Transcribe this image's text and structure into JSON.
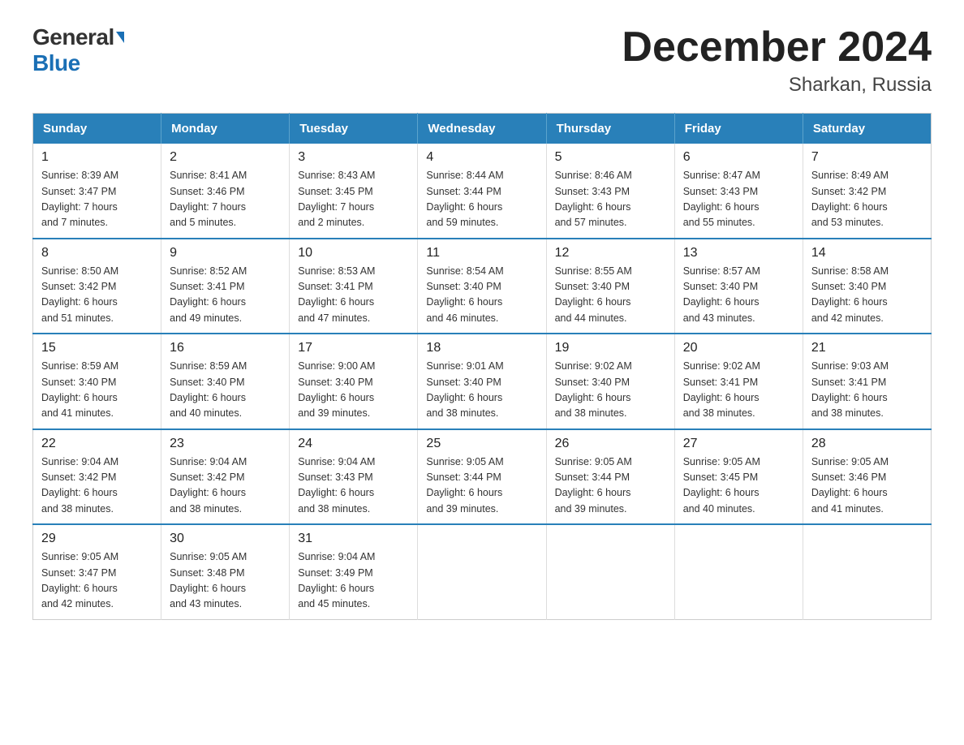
{
  "logo": {
    "general": "General",
    "blue": "Blue"
  },
  "title": "December 2024",
  "subtitle": "Sharkan, Russia",
  "headers": [
    "Sunday",
    "Monday",
    "Tuesday",
    "Wednesday",
    "Thursday",
    "Friday",
    "Saturday"
  ],
  "weeks": [
    [
      {
        "day": "1",
        "sunrise": "8:39 AM",
        "sunset": "3:47 PM",
        "daylight": "7 hours and 7 minutes."
      },
      {
        "day": "2",
        "sunrise": "8:41 AM",
        "sunset": "3:46 PM",
        "daylight": "7 hours and 5 minutes."
      },
      {
        "day": "3",
        "sunrise": "8:43 AM",
        "sunset": "3:45 PM",
        "daylight": "7 hours and 2 minutes."
      },
      {
        "day": "4",
        "sunrise": "8:44 AM",
        "sunset": "3:44 PM",
        "daylight": "6 hours and 59 minutes."
      },
      {
        "day": "5",
        "sunrise": "8:46 AM",
        "sunset": "3:43 PM",
        "daylight": "6 hours and 57 minutes."
      },
      {
        "day": "6",
        "sunrise": "8:47 AM",
        "sunset": "3:43 PM",
        "daylight": "6 hours and 55 minutes."
      },
      {
        "day": "7",
        "sunrise": "8:49 AM",
        "sunset": "3:42 PM",
        "daylight": "6 hours and 53 minutes."
      }
    ],
    [
      {
        "day": "8",
        "sunrise": "8:50 AM",
        "sunset": "3:42 PM",
        "daylight": "6 hours and 51 minutes."
      },
      {
        "day": "9",
        "sunrise": "8:52 AM",
        "sunset": "3:41 PM",
        "daylight": "6 hours and 49 minutes."
      },
      {
        "day": "10",
        "sunrise": "8:53 AM",
        "sunset": "3:41 PM",
        "daylight": "6 hours and 47 minutes."
      },
      {
        "day": "11",
        "sunrise": "8:54 AM",
        "sunset": "3:40 PM",
        "daylight": "6 hours and 46 minutes."
      },
      {
        "day": "12",
        "sunrise": "8:55 AM",
        "sunset": "3:40 PM",
        "daylight": "6 hours and 44 minutes."
      },
      {
        "day": "13",
        "sunrise": "8:57 AM",
        "sunset": "3:40 PM",
        "daylight": "6 hours and 43 minutes."
      },
      {
        "day": "14",
        "sunrise": "8:58 AM",
        "sunset": "3:40 PM",
        "daylight": "6 hours and 42 minutes."
      }
    ],
    [
      {
        "day": "15",
        "sunrise": "8:59 AM",
        "sunset": "3:40 PM",
        "daylight": "6 hours and 41 minutes."
      },
      {
        "day": "16",
        "sunrise": "8:59 AM",
        "sunset": "3:40 PM",
        "daylight": "6 hours and 40 minutes."
      },
      {
        "day": "17",
        "sunrise": "9:00 AM",
        "sunset": "3:40 PM",
        "daylight": "6 hours and 39 minutes."
      },
      {
        "day": "18",
        "sunrise": "9:01 AM",
        "sunset": "3:40 PM",
        "daylight": "6 hours and 38 minutes."
      },
      {
        "day": "19",
        "sunrise": "9:02 AM",
        "sunset": "3:40 PM",
        "daylight": "6 hours and 38 minutes."
      },
      {
        "day": "20",
        "sunrise": "9:02 AM",
        "sunset": "3:41 PM",
        "daylight": "6 hours and 38 minutes."
      },
      {
        "day": "21",
        "sunrise": "9:03 AM",
        "sunset": "3:41 PM",
        "daylight": "6 hours and 38 minutes."
      }
    ],
    [
      {
        "day": "22",
        "sunrise": "9:04 AM",
        "sunset": "3:42 PM",
        "daylight": "6 hours and 38 minutes."
      },
      {
        "day": "23",
        "sunrise": "9:04 AM",
        "sunset": "3:42 PM",
        "daylight": "6 hours and 38 minutes."
      },
      {
        "day": "24",
        "sunrise": "9:04 AM",
        "sunset": "3:43 PM",
        "daylight": "6 hours and 38 minutes."
      },
      {
        "day": "25",
        "sunrise": "9:05 AM",
        "sunset": "3:44 PM",
        "daylight": "6 hours and 39 minutes."
      },
      {
        "day": "26",
        "sunrise": "9:05 AM",
        "sunset": "3:44 PM",
        "daylight": "6 hours and 39 minutes."
      },
      {
        "day": "27",
        "sunrise": "9:05 AM",
        "sunset": "3:45 PM",
        "daylight": "6 hours and 40 minutes."
      },
      {
        "day": "28",
        "sunrise": "9:05 AM",
        "sunset": "3:46 PM",
        "daylight": "6 hours and 41 minutes."
      }
    ],
    [
      {
        "day": "29",
        "sunrise": "9:05 AM",
        "sunset": "3:47 PM",
        "daylight": "6 hours and 42 minutes."
      },
      {
        "day": "30",
        "sunrise": "9:05 AM",
        "sunset": "3:48 PM",
        "daylight": "6 hours and 43 minutes."
      },
      {
        "day": "31",
        "sunrise": "9:04 AM",
        "sunset": "3:49 PM",
        "daylight": "6 hours and 45 minutes."
      },
      null,
      null,
      null,
      null
    ]
  ],
  "labels": {
    "sunrise": "Sunrise:",
    "sunset": "Sunset:",
    "daylight": "Daylight:"
  }
}
